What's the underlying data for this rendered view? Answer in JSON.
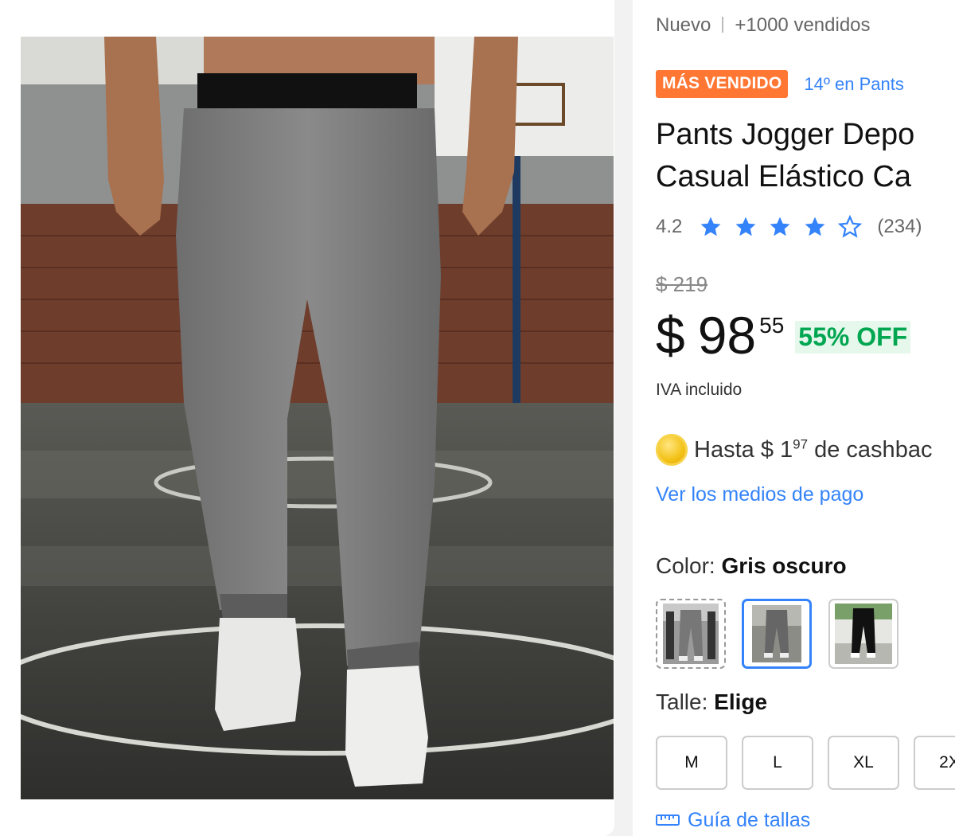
{
  "product": {
    "condition": "Nuevo",
    "sold": "+1000 vendidos",
    "badge": "MÁS VENDIDO",
    "rank": "14º en Pants",
    "title": "Pants Jogger Depo\nCasual Elástico Ca",
    "rating_value": "4.2",
    "rating_stars": 4.2,
    "reviews": "(234)",
    "old_price": "$ 219",
    "price_currency": "$",
    "price_int": "98",
    "price_dec": "55",
    "discount": "55% OFF",
    "tax_note": "IVA incluido",
    "cashback_prefix": "Hasta $ 1",
    "cashback_cents": "97",
    "cashback_suffix": " de cashbac",
    "payment_link": "Ver los medios de pago",
    "color_label": "Color:",
    "color_value": "Gris oscuro",
    "color_options": [
      "gym-gray",
      "gray",
      "black"
    ],
    "size_label": "Talle:",
    "size_value": "Elige",
    "sizes": [
      "M",
      "L",
      "XL",
      "2X"
    ],
    "size_guide": "Guía de tallas"
  },
  "colors": {
    "accent": "#3483fa",
    "badge": "#ff7733",
    "discount": "#00a650",
    "star": "#3483fa"
  }
}
